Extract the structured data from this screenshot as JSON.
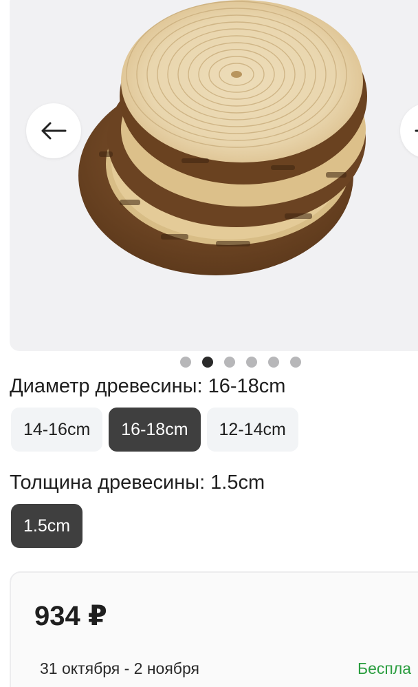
{
  "gallery": {
    "image_alt": "wood-slices-photo",
    "prev_icon": "arrow-left-icon",
    "next_icon": "arrow-right-icon",
    "dots_total": 6,
    "dots_active_index": 1
  },
  "diameter": {
    "title": "Диаметр древесины: 16-18cm",
    "options": [
      {
        "label": "14-16cm",
        "selected": false
      },
      {
        "label": "16-18cm",
        "selected": true
      },
      {
        "label": "12-14cm",
        "selected": false
      }
    ]
  },
  "thickness": {
    "title": "Толщина древесины: 1.5cm",
    "options": [
      {
        "label": "1.5cm",
        "selected": true
      }
    ]
  },
  "price_card": {
    "price": "934 ₽",
    "delivery_dates": "31 октября - 2 ноября",
    "delivery_cost": "Беспла"
  },
  "colors": {
    "selected_chip": "#3f3f3f",
    "chip": "#f2f4f6",
    "free_delivery": "#2a9d3f"
  }
}
